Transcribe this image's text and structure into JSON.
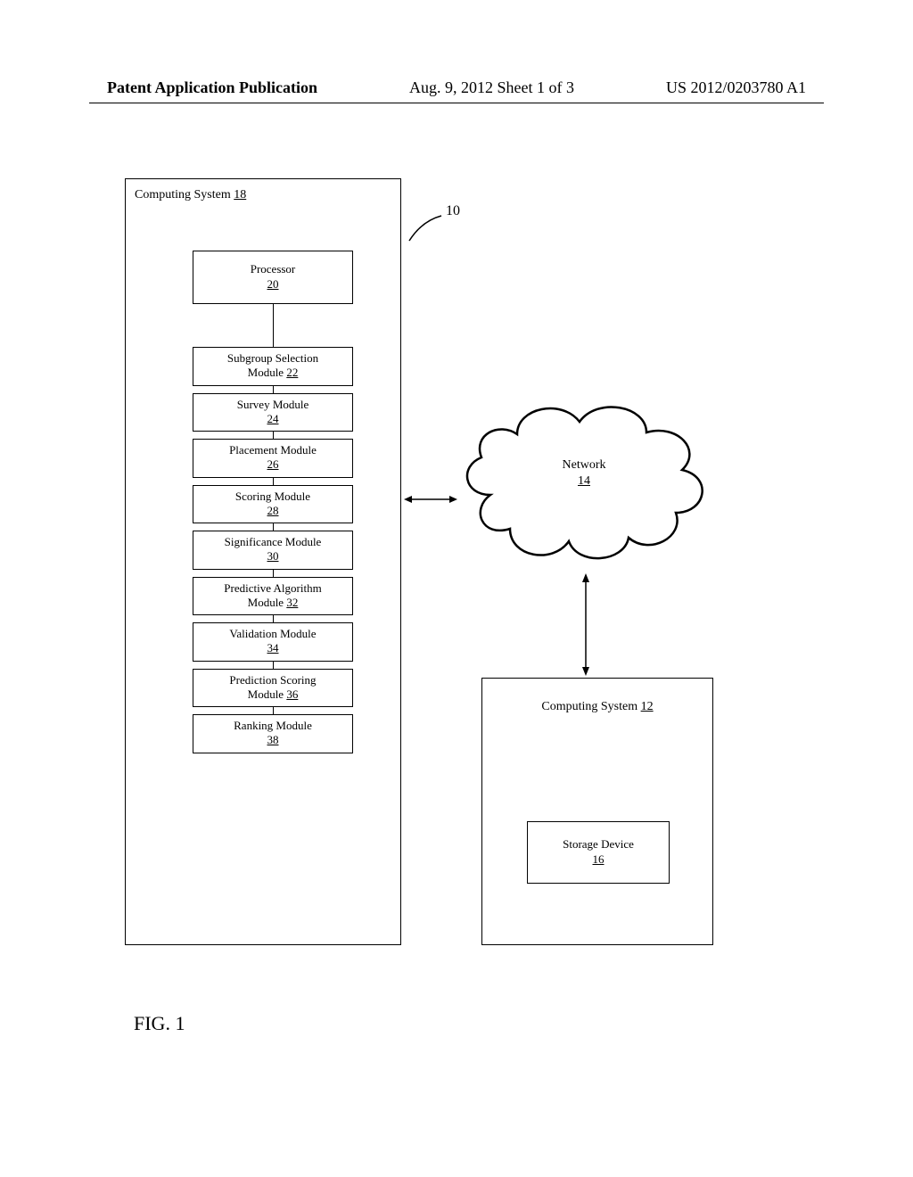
{
  "header": {
    "left": "Patent Application Publication",
    "center": "Aug. 9, 2012  Sheet 1 of 3",
    "right": "US 2012/0203780 A1"
  },
  "figure_label": "FIG. 1",
  "leader_10": "10",
  "sys18": {
    "title_prefix": "Computing System ",
    "ref": "18"
  },
  "modules": [
    {
      "label": "Processor",
      "ref": "20",
      "conn": 48,
      "tall": true
    },
    {
      "label": "Subgroup Selection Module",
      "ref": "22",
      "conn": 8
    },
    {
      "label": "Survey Module",
      "ref": "24",
      "conn": 8
    },
    {
      "label": "Placement Module",
      "ref": "26",
      "conn": 8
    },
    {
      "label": "Scoring Module",
      "ref": "28",
      "conn": 8
    },
    {
      "label": "Significance Module",
      "ref": "30",
      "conn": 8
    },
    {
      "label": "Predictive Algorithm Module",
      "ref": "32",
      "conn": 8
    },
    {
      "label": "Validation Module",
      "ref": "34",
      "conn": 8
    },
    {
      "label": "Prediction Scoring Module",
      "ref": "36",
      "conn": 8
    },
    {
      "label": "Ranking Module",
      "ref": "38",
      "conn": 0
    }
  ],
  "cloud": {
    "label": "Network",
    "ref": "14"
  },
  "sys12": {
    "title_prefix": "Computing System ",
    "ref": "12"
  },
  "storage": {
    "label": "Storage Device",
    "ref": "16"
  }
}
